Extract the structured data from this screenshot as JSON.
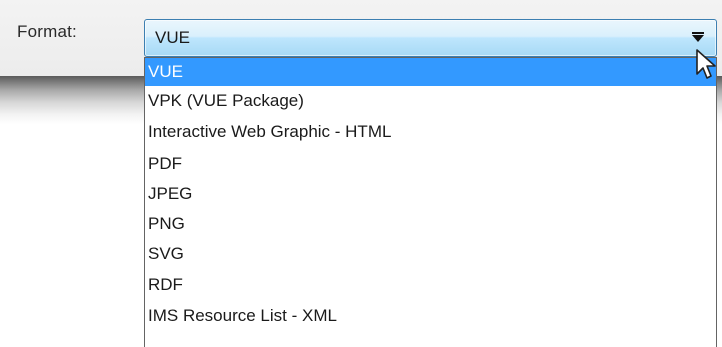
{
  "format_field": {
    "label": "Format:",
    "selected_value": "VUE"
  },
  "dropdown": {
    "options": [
      {
        "label": "VUE",
        "selected": true
      },
      {
        "label": "VPK (VUE Package)",
        "selected": false
      },
      {
        "label": "Interactive Web Graphic - HTML",
        "selected": false
      },
      {
        "label": "PDF",
        "selected": false
      },
      {
        "label": "JPEG",
        "selected": false
      },
      {
        "label": "PNG",
        "selected": false
      },
      {
        "label": "SVG",
        "selected": false
      },
      {
        "label": "RDF",
        "selected": false
      },
      {
        "label": "IMS Resource List - XML",
        "selected": false
      }
    ]
  },
  "colors": {
    "selection_highlight": "#3399ff",
    "combo_border": "#3c7fb1"
  },
  "icons": {
    "dropdown_arrow": "chevron-down-icon",
    "cursor": "mouse-pointer-icon"
  }
}
